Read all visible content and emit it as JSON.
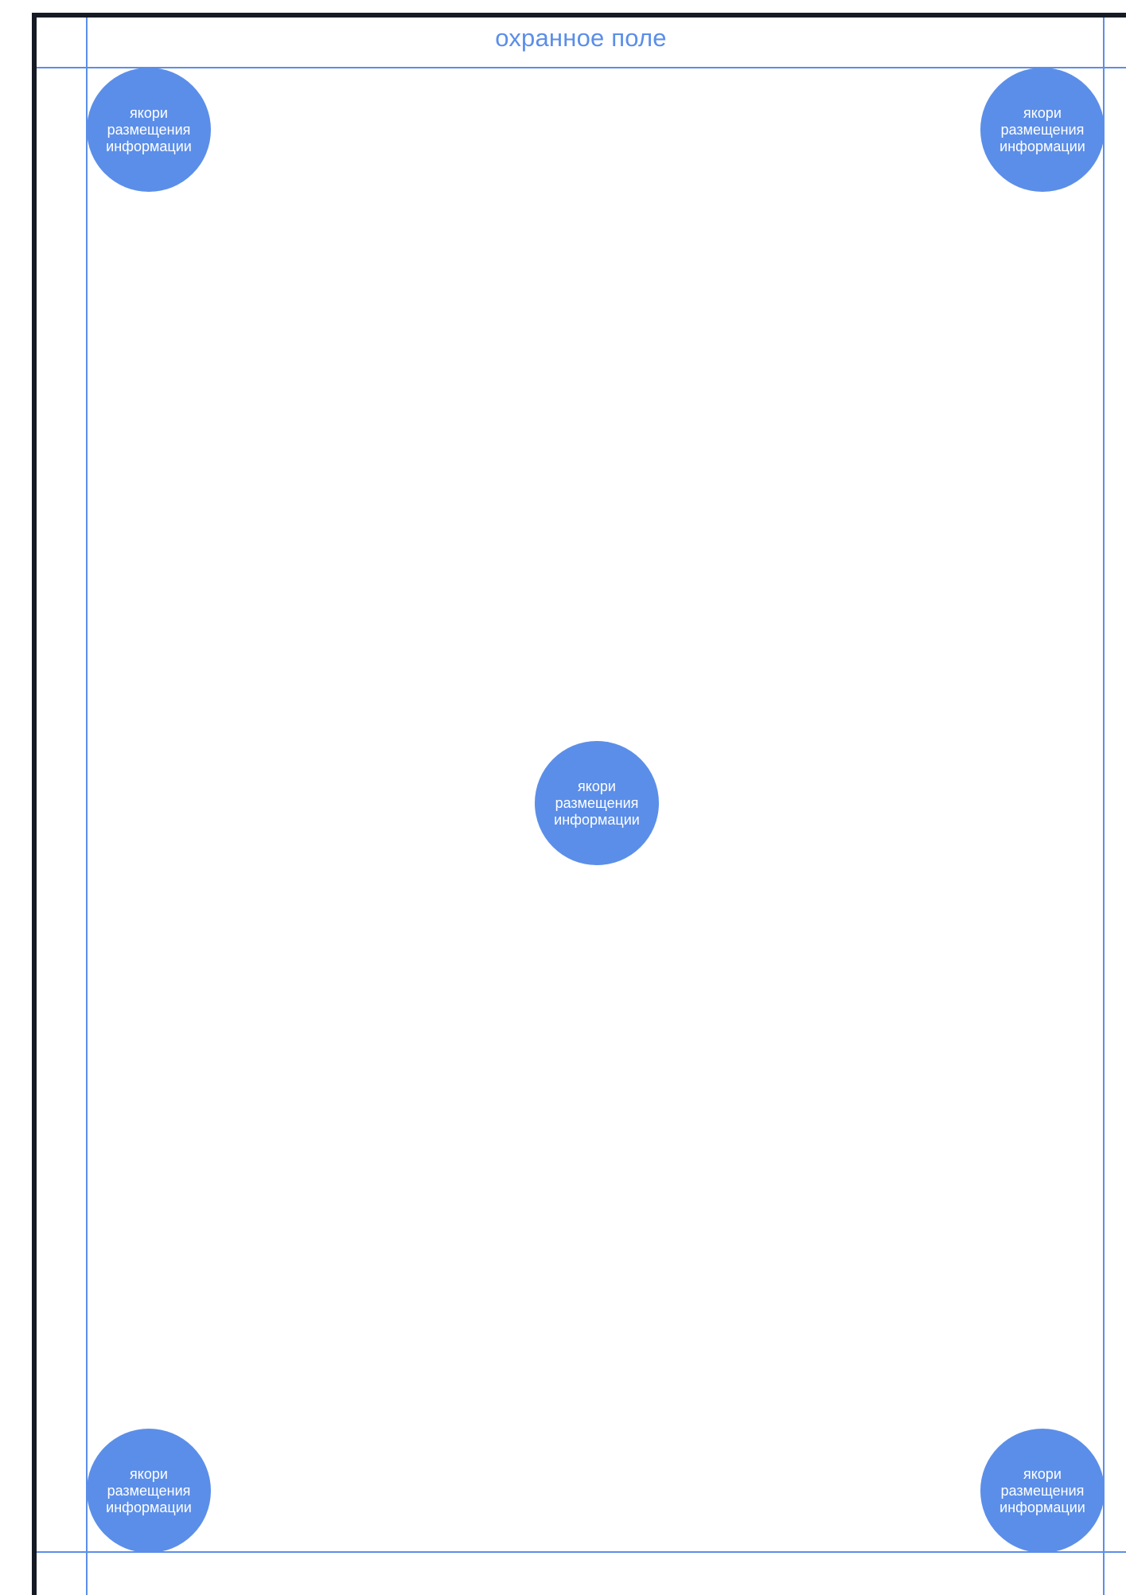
{
  "layout": {
    "safe_zone_label": "охранное поле",
    "anchor_label": "якори\nразмещения\nинформации",
    "colors": {
      "guide": "#5b8ee8",
      "frame": "#161a24",
      "anchor_fill": "#5b8ee8",
      "anchor_text": "#ffffff",
      "background": "#ffffff"
    }
  },
  "anchors": [
    {
      "position": "top-left",
      "label": "якори\nразмещения\nинформации"
    },
    {
      "position": "top-right",
      "label": "якори\nразмещения\nинформации"
    },
    {
      "position": "center",
      "label": "якори\nразмещения\nинформации"
    },
    {
      "position": "bottom-left",
      "label": "якори\nразмещения\nинформации"
    },
    {
      "position": "bottom-right",
      "label": "якори\nразмещения\nинформации"
    }
  ]
}
